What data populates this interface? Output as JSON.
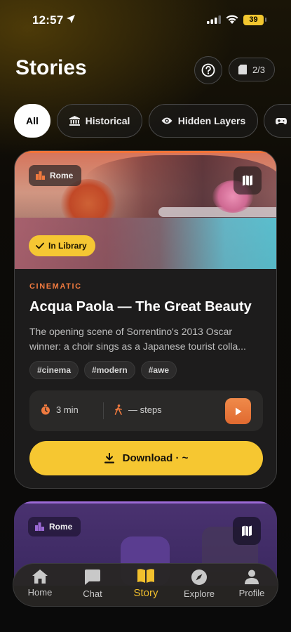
{
  "status_bar": {
    "time": "12:57",
    "battery": "39"
  },
  "header": {
    "title": "Stories",
    "count": "2/3"
  },
  "filters": [
    {
      "label": "All",
      "active": true
    },
    {
      "label": "Historical",
      "active": false
    },
    {
      "label": "Hidden Layers",
      "active": false
    },
    {
      "label": "",
      "active": false
    }
  ],
  "cards": [
    {
      "location": "Rome",
      "library_badge": "In Library",
      "category": "CINEMATIC",
      "title": "Acqua Paola — The Great Beauty",
      "description": "The opening scene of Sorrentino's 2013 Oscar winner: a choir sings as a Japanese tourist colla...",
      "tags": [
        "#cinema",
        "#modern",
        "#awe"
      ],
      "duration": "3 min",
      "steps": "— steps",
      "download_label": "Download · ~",
      "accent": "#f07a3f"
    },
    {
      "location": "Rome",
      "accent": "#9c6ad6"
    }
  ],
  "tabs": [
    {
      "label": "Home",
      "icon": "home-icon"
    },
    {
      "label": "Chat",
      "icon": "chat-icon"
    },
    {
      "label": "Story",
      "icon": "book-icon",
      "active": true
    },
    {
      "label": "Explore",
      "icon": "compass-icon"
    },
    {
      "label": "Profile",
      "icon": "person-icon"
    }
  ],
  "colors": {
    "accent_yellow": "#f6c731",
    "accent_orange": "#f07a3f",
    "background": "#0b0a08"
  }
}
